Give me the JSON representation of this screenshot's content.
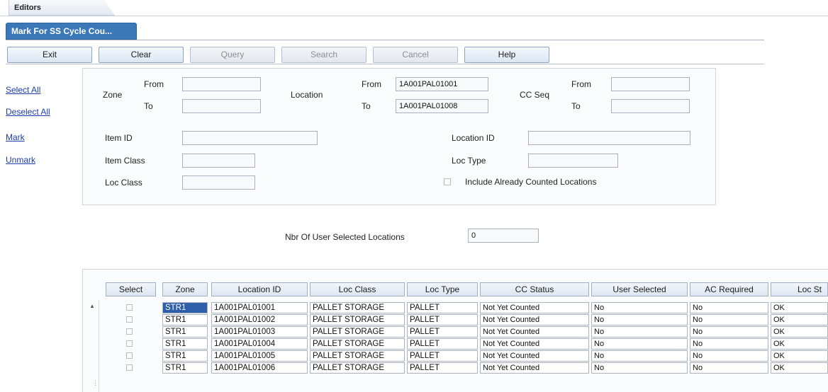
{
  "editors_tab": {
    "label": "Editors"
  },
  "form_tab": {
    "label": "Mark For SS Cycle Cou..."
  },
  "toolbar": {
    "exit": "Exit",
    "clear": "Clear",
    "query": "Query",
    "search": "Search",
    "cancel": "Cancel",
    "help": "Help"
  },
  "sidebar": {
    "select_all": "Select All",
    "deselect_all": "Deselect All",
    "mark": "Mark",
    "unmark": "Unmark"
  },
  "filters": {
    "zone_label": "Zone",
    "location_label": "Location",
    "ccseq_label": "CC Seq",
    "from_label": "From",
    "to_label": "To",
    "zone_from": "",
    "zone_to": "",
    "location_from": "1A001PAL01001",
    "location_to": "1A001PAL01008",
    "ccseq_from": "",
    "ccseq_to": "",
    "item_id_label": "Item ID",
    "item_id": "",
    "item_class_label": "Item Class",
    "item_class": "",
    "loc_class_label": "Loc Class",
    "loc_class": "",
    "location_id_label": "Location ID",
    "location_id": "",
    "loc_type_label": "Loc Type",
    "loc_type": "",
    "include_counted_label": "Include Already Counted Locations",
    "include_counted": false
  },
  "summary": {
    "nbr_selected_label": "Nbr Of User Selected Locations",
    "nbr_selected": "0"
  },
  "grid": {
    "columns": [
      "Select",
      "Zone",
      "Location ID",
      "Loc Class",
      "Loc Type",
      "CC Status",
      "User Selected",
      "AC Required",
      "Loc St"
    ],
    "rows": [
      {
        "zone": "STR1",
        "location_id": "1A001PAL01001",
        "loc_class": "PALLET STORAGE",
        "loc_type": "PALLET",
        "cc_status": "Not Yet Counted",
        "user_selected": "No",
        "ac_required": "No",
        "loc_status": "OK"
      },
      {
        "zone": "STR1",
        "location_id": "1A001PAL01002",
        "loc_class": "PALLET STORAGE",
        "loc_type": "PALLET",
        "cc_status": "Not Yet Counted",
        "user_selected": "No",
        "ac_required": "No",
        "loc_status": "OK"
      },
      {
        "zone": "STR1",
        "location_id": "1A001PAL01003",
        "loc_class": "PALLET STORAGE",
        "loc_type": "PALLET",
        "cc_status": "Not Yet Counted",
        "user_selected": "No",
        "ac_required": "No",
        "loc_status": "OK"
      },
      {
        "zone": "STR1",
        "location_id": "1A001PAL01004",
        "loc_class": "PALLET STORAGE",
        "loc_type": "PALLET",
        "cc_status": "Not Yet Counted",
        "user_selected": "No",
        "ac_required": "No",
        "loc_status": "OK"
      },
      {
        "zone": "STR1",
        "location_id": "1A001PAL01005",
        "loc_class": "PALLET STORAGE",
        "loc_type": "PALLET",
        "cc_status": "Not Yet Counted",
        "user_selected": "No",
        "ac_required": "No",
        "loc_status": "OK"
      },
      {
        "zone": "STR1",
        "location_id": "1A001PAL01006",
        "loc_class": "PALLET STORAGE",
        "loc_type": "PALLET",
        "cc_status": "Not Yet Counted",
        "user_selected": "No",
        "ac_required": "No",
        "loc_status": "OK"
      }
    ]
  },
  "colors": {
    "tab_blue": "#3b78b8",
    "link_blue": "#1f3fae",
    "selected_cell": "#2e5fa8"
  }
}
